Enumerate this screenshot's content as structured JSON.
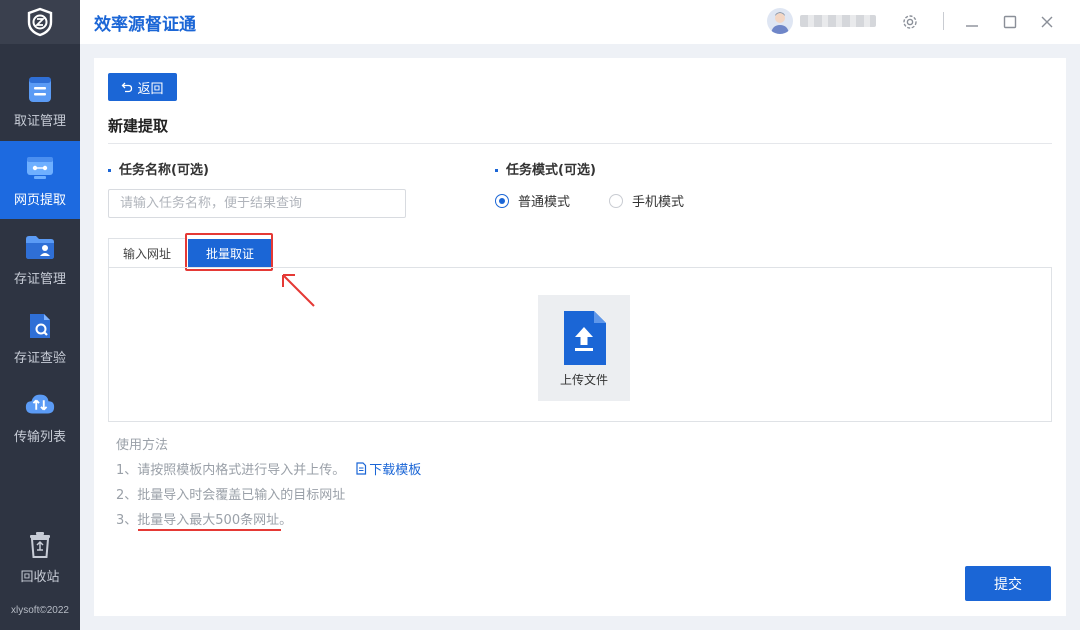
{
  "app": {
    "title": "效率源督证通"
  },
  "sidebar": {
    "items": [
      {
        "label": "取证管理",
        "icon": "evidence-management-icon",
        "active": false
      },
      {
        "label": "网页提取",
        "icon": "web-extract-icon",
        "active": true
      },
      {
        "label": "存证管理",
        "icon": "storage-folder-icon",
        "active": false
      },
      {
        "label": "存证查验",
        "icon": "verify-document-icon",
        "active": false
      },
      {
        "label": "传输列表",
        "icon": "cloud-transfer-icon",
        "active": false
      }
    ],
    "recycle_label": "回收站",
    "copyright": "xlysoft©2022"
  },
  "header": {
    "icons": [
      "avatar",
      "settings-gear-icon",
      "minimize-icon",
      "maximize-icon",
      "close-icon"
    ]
  },
  "page": {
    "back_label": "返回",
    "title": "新建提取",
    "task_name_label": "任务名称(可选)",
    "task_name_placeholder": "请输入任务名称，便于结果查询",
    "task_name_value": "",
    "task_mode_label": "任务模式(可选)",
    "modes": [
      {
        "label": "普通模式",
        "checked": true
      },
      {
        "label": "手机模式",
        "checked": false
      }
    ],
    "tabs": [
      {
        "label": "输入网址",
        "active": false
      },
      {
        "label": "批量取证",
        "active": true
      }
    ],
    "upload_label": "上传文件",
    "usage": {
      "title": "使用方法",
      "line1": "1、请按照模板内格式进行导入并上传。",
      "download_label": "下载模板",
      "line2": "2、批量导入时会覆盖已输入的目标网址",
      "line3": "3、批量导入最大500条网址。"
    },
    "submit_label": "提交"
  },
  "colors": {
    "accent": "#1b66d6",
    "sidebar": "#2e3442",
    "highlight": "#e53935"
  }
}
